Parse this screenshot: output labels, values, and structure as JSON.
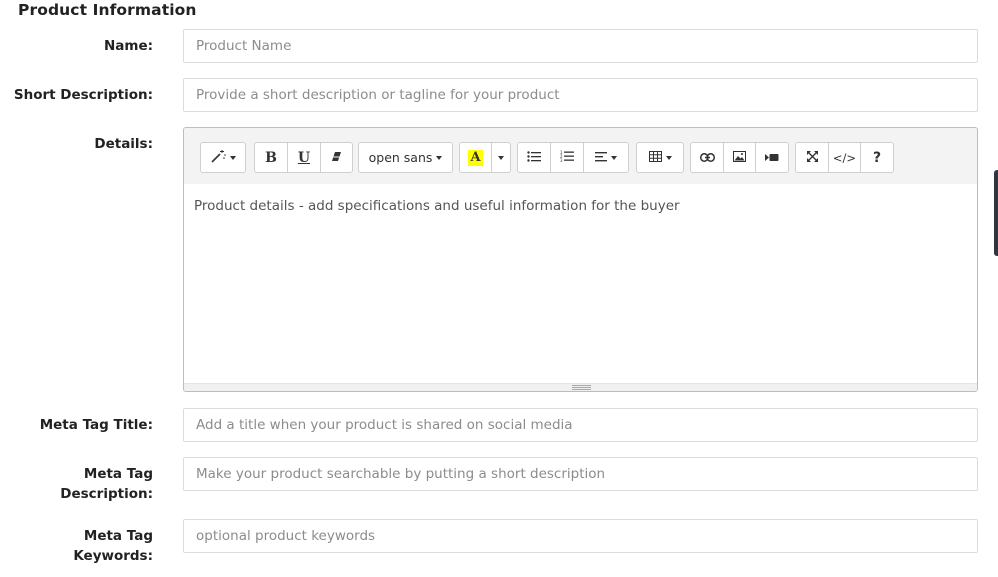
{
  "section": {
    "title": "Product Information"
  },
  "fields": {
    "name": {
      "label": "Name:",
      "placeholder": "Product Name",
      "value": ""
    },
    "short_description": {
      "label": "Short Description:",
      "placeholder": "Provide a short description or tagline for your product",
      "value": ""
    },
    "details": {
      "label": "Details:"
    },
    "meta_title": {
      "label": "Meta Tag Title:",
      "placeholder": "Add a title when your product is shared on social media",
      "value": ""
    },
    "meta_description": {
      "label_line1": "Meta Tag",
      "label_line2": "Description:",
      "placeholder": "Make your product searchable by putting a short description",
      "value": ""
    },
    "meta_keywords": {
      "label_line1": "Meta Tag",
      "label_line2": "Keywords:",
      "placeholder": "optional product keywords",
      "value": ""
    }
  },
  "editor": {
    "content": "Product details - add specifications and useful information for the buyer",
    "font_name": "open sans",
    "toolbar": {
      "bold_label": "B",
      "underline_label": "U",
      "color_label": "A",
      "codeview_label": "</>",
      "help_label": "?"
    },
    "highlight_color": "#ffff00"
  }
}
